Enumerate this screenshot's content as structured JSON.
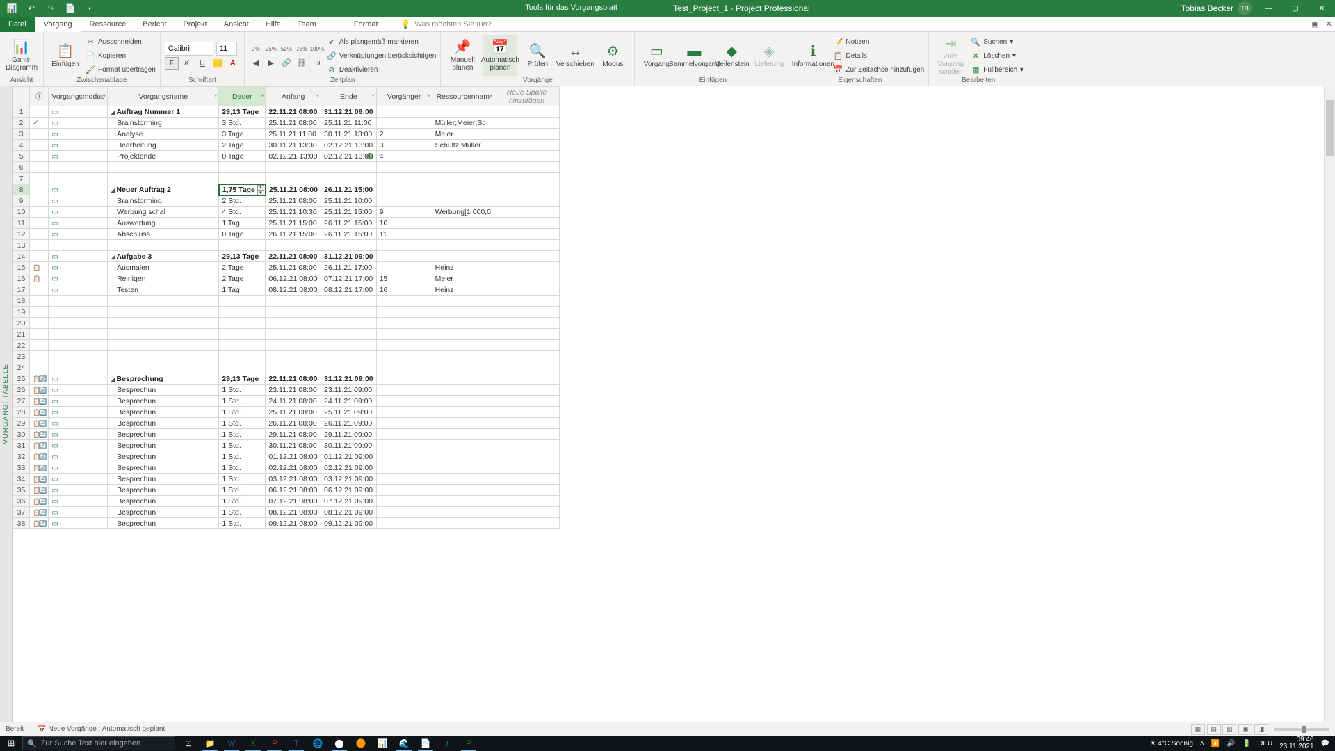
{
  "title": {
    "tools": "Tools für das Vorgangsblatt",
    "doc": "Test_Project_1  -  Project Professional"
  },
  "user": {
    "name": "Tobias Becker",
    "initials": "TB"
  },
  "tabs": {
    "file": "Datei",
    "task": "Vorgang",
    "resource": "Ressource",
    "report": "Bericht",
    "project": "Projekt",
    "view": "Ansicht",
    "help": "Hilfe",
    "team": "Team",
    "format": "Format",
    "tell": "Was möchten Sie tun?"
  },
  "ribbon": {
    "gantt": "Gantt-\nDiagramm",
    "view": "Ansicht",
    "paste": "Einfügen",
    "cut": "Ausschneiden",
    "copy": "Kopieren",
    "fmtpaint": "Format übertragen",
    "clipboard": "Zwischenablage",
    "font": "Calibri",
    "size": "11",
    "fontgrp": "Schriftart",
    "onplan": "Als plangemäß markieren",
    "links": "Verknüpfungen berücksichtigen",
    "deact": "Deaktivieren",
    "schedule": "Zeitplan",
    "manual": "Manuell\nplanen",
    "auto": "Automatisch\nplanen",
    "inspect": "Prüfen",
    "move": "Verschieben",
    "mode": "Modus",
    "tasks": "Vorgänge",
    "task": "Vorgang",
    "summary": "Sammelvorgang",
    "milestone": "Meilenstein",
    "deliv": "Lieferung",
    "insert": "Einfügen",
    "info": "Informationen",
    "notes": "Notizen",
    "details": "Details",
    "timeline": "Zur Zeitachse hinzufügen",
    "props": "Eigenschaften",
    "goto": "Zum Vorgang\nscrollen",
    "find": "Suchen",
    "delete": "Löschen",
    "fill": "Füllbereich",
    "edit": "Bearbeiten"
  },
  "cols": {
    "ind": "",
    "mode": "Vorgangsmodus",
    "name": "Vorgangsname",
    "dur": "Dauer",
    "start": "Anfang",
    "end": "Ende",
    "pred": "Vorgänger",
    "res": "Ressourcennam",
    "add": "Neue Spalte\nhinzufügen"
  },
  "sidevert": "VORGANG: TABELLE",
  "rows": [
    {
      "n": 1,
      "ind": "",
      "sum": true,
      "name": "Auftrag Nummer 1",
      "dur": "29,13 Tage",
      "s": "22.11.21 08:00",
      "e": "31.12.21 09:00",
      "p": "",
      "r": ""
    },
    {
      "n": 2,
      "ind": "✓",
      "name": "Brainstorming",
      "dur": "3 Std.",
      "s": "25.11.21 08:00",
      "e": "25.11.21 11:00",
      "p": "",
      "r": "Müller;Meier;Sc"
    },
    {
      "n": 3,
      "name": "Analyse",
      "dur": "3 Tage",
      "s": "25.11.21 11:00",
      "e": "30.11.21 13:00",
      "p": "2",
      "r": "Meier"
    },
    {
      "n": 4,
      "name": "Bearbeitung",
      "dur": "2 Tage",
      "s": "30.11.21 13:30",
      "e": "02.12.21 13:00",
      "p": "3",
      "r": "Schultz;Müller"
    },
    {
      "n": 5,
      "name": "Projektende",
      "dur": "0 Tage",
      "s": "02.12.21 13:00",
      "e": "02.12.21 13:00",
      "p": "4",
      "r": ""
    },
    {
      "n": 6,
      "empty": true
    },
    {
      "n": 7,
      "empty": true
    },
    {
      "n": 8,
      "sum": true,
      "sel": true,
      "name": "Neuer Auftrag 2",
      "dur": "1,75 Tage",
      "s": "25.11.21 08:00",
      "e": "26.11.21 15:00"
    },
    {
      "n": 9,
      "name": "Brainstorming",
      "dur": "2 Std.",
      "s": "25.11.21 08:00",
      "e": "25.11.21 10:00"
    },
    {
      "n": 10,
      "name": "Werbung schal",
      "dur": "4 Std.",
      "s": "25.11.21 10:30",
      "e": "25.11.21 15:00",
      "p": "9",
      "r": "Werbung[1 000,0"
    },
    {
      "n": 11,
      "name": "Auswertung",
      "dur": "1 Tag",
      "s": "25.11.21 15:00",
      "e": "26.11.21 15:00",
      "p": "10"
    },
    {
      "n": 12,
      "name": "Abschluss",
      "dur": "0 Tage",
      "s": "26.11.21 15:00",
      "e": "26.11.21 15:00",
      "p": "11"
    },
    {
      "n": 13,
      "empty": true
    },
    {
      "n": 14,
      "sum": true,
      "name": "Aufgabe 3",
      "dur": "29,13 Tage",
      "s": "22.11.21 08:00",
      "e": "31.12.21 09:00"
    },
    {
      "n": 15,
      "ind": "📋",
      "name": "Ausmalen",
      "dur": "2 Tage",
      "s": "25.11.21 08:00",
      "e": "26.11.21 17:00",
      "r": "Heinz"
    },
    {
      "n": 16,
      "ind": "📋",
      "name": "Reinigen",
      "dur": "2 Tage",
      "s": "06.12.21 08:00",
      "e": "07.12.21 17:00",
      "p": "15",
      "r": "Meier"
    },
    {
      "n": 17,
      "name": "Testen",
      "dur": "1 Tag",
      "s": "08.12.21 08:00",
      "e": "08.12.21 17:00",
      "p": "16",
      "r": "Heinz"
    },
    {
      "n": 18,
      "empty": true
    },
    {
      "n": 19,
      "empty": true
    },
    {
      "n": 20,
      "empty": true
    },
    {
      "n": 21,
      "empty": true
    },
    {
      "n": 22,
      "empty": true
    },
    {
      "n": 23,
      "empty": true
    },
    {
      "n": 24,
      "empty": true
    },
    {
      "n": 25,
      "dbl": true,
      "sum": true,
      "name": "Besprechung",
      "dur": "29,13 Tage",
      "s": "22.11.21 08:00",
      "e": "31.12.21 09:00"
    },
    {
      "n": 26,
      "dbl": true,
      "name": "Besprechun",
      "dur": "1 Std.",
      "s": "23.11.21 08:00",
      "e": "23.11.21 09:00"
    },
    {
      "n": 27,
      "dbl": true,
      "name": "Besprechun",
      "dur": "1 Std.",
      "s": "24.11.21 08:00",
      "e": "24.11.21 09:00"
    },
    {
      "n": 28,
      "dbl": true,
      "name": "Besprechun",
      "dur": "1 Std.",
      "s": "25.11.21 08:00",
      "e": "25.11.21 09:00"
    },
    {
      "n": 29,
      "dbl": true,
      "name": "Besprechun",
      "dur": "1 Std.",
      "s": "26.11.21 08:00",
      "e": "26.11.21 09:00"
    },
    {
      "n": 30,
      "dbl": true,
      "name": "Besprechun",
      "dur": "1 Std.",
      "s": "29.11.21 08:00",
      "e": "29.11.21 09:00"
    },
    {
      "n": 31,
      "dbl": true,
      "name": "Besprechun",
      "dur": "1 Std.",
      "s": "30.11.21 08:00",
      "e": "30.11.21 09:00"
    },
    {
      "n": 32,
      "dbl": true,
      "name": "Besprechun",
      "dur": "1 Std.",
      "s": "01.12.21 08:00",
      "e": "01.12.21 09:00"
    },
    {
      "n": 33,
      "dbl": true,
      "name": "Besprechun",
      "dur": "1 Std.",
      "s": "02.12.21 08:00",
      "e": "02.12.21 09:00"
    },
    {
      "n": 34,
      "dbl": true,
      "name": "Besprechun",
      "dur": "1 Std.",
      "s": "03.12.21 08:00",
      "e": "03.12.21 09:00"
    },
    {
      "n": 35,
      "dbl": true,
      "name": "Besprechun",
      "dur": "1 Std.",
      "s": "06.12.21 08:00",
      "e": "06.12.21 09:00"
    },
    {
      "n": 36,
      "dbl": true,
      "name": "Besprechun",
      "dur": "1 Std.",
      "s": "07.12.21 08:00",
      "e": "07.12.21 09:00"
    },
    {
      "n": 37,
      "dbl": true,
      "name": "Besprechun",
      "dur": "1 Std.",
      "s": "08.12.21 08:00",
      "e": "08.12.21 09:00"
    },
    {
      "n": 38,
      "dbl": true,
      "name": "Besprechun",
      "dur": "1 Std.",
      "s": "09.12.21 08:00",
      "e": "09.12.21 09:00"
    }
  ],
  "status": {
    "ready": "Bereit",
    "auto": "Neue Vorgänge : Automatisch geplant"
  },
  "taskbar": {
    "search": "Zur Suche Text hier eingeben",
    "weather": "4°C Sonnig",
    "lang": "DEU",
    "time": "09:46",
    "date": "23.11.2021"
  }
}
